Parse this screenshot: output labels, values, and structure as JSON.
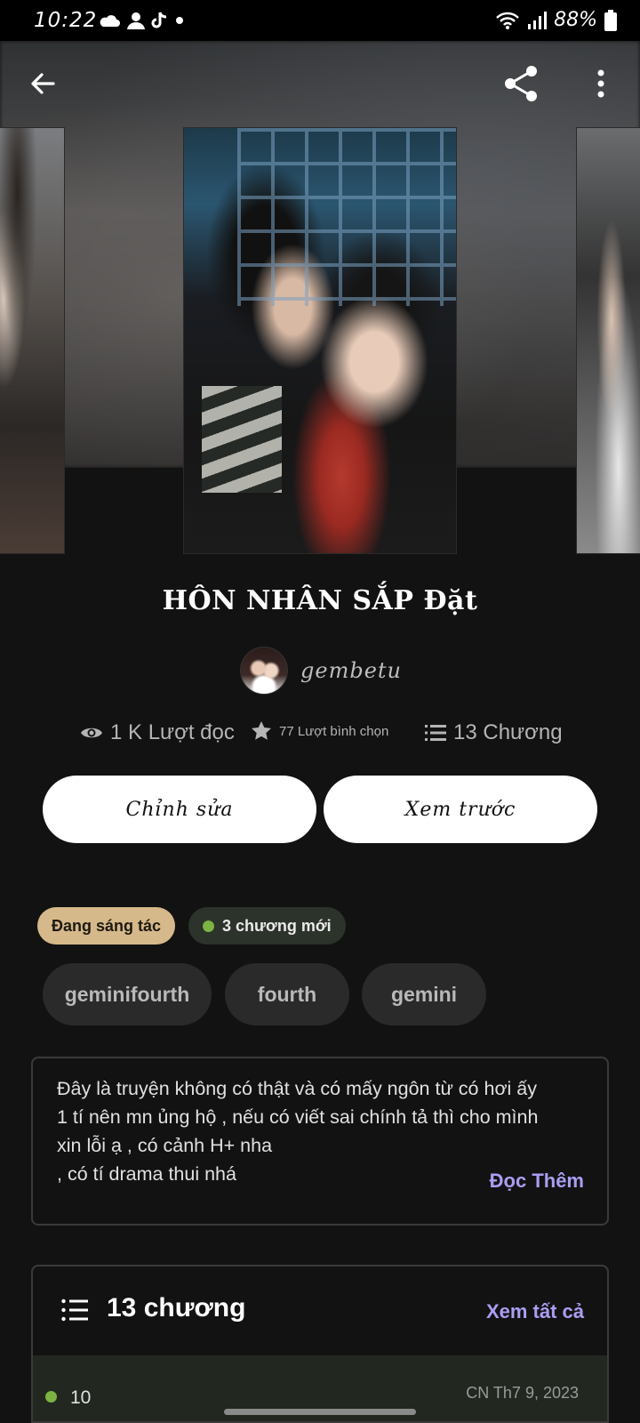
{
  "status_bar": {
    "time": "10:22",
    "battery": "88%",
    "icons_left": [
      "cloud-icon",
      "person-icon",
      "tiktok-icon",
      "dot-icon"
    ],
    "icons_right": [
      "wifi-icon",
      "signal-icon",
      "battery-icon"
    ]
  },
  "nav": {
    "back_icon": "back-arrow-icon",
    "share_icon": "share-icon",
    "more_icon": "more-vertical-icon"
  },
  "story": {
    "title": "HÔN NHÂN SẮP Đặt",
    "author": "gembetu"
  },
  "stats": {
    "reads": "1 K Lượt đọc",
    "votes": "77 Lượt bình chọn",
    "chapters": "13 Chương"
  },
  "actions": {
    "edit": "Chỉnh sửa",
    "preview": "Xem trước"
  },
  "badges": {
    "status": "Đang sáng tác",
    "new_chapters": "3 chương mới"
  },
  "tags": [
    "geminifourth",
    "fourth",
    "gemini"
  ],
  "description": {
    "text": "Đây là truyện không có thật và có mấy ngôn từ có hơi ấy\n1 tí nên mn ủng hộ , nếu có viết sai chính tả thì cho mình\nxin lỗi ạ , có cảnh H+ nha\n, có tí drama thui nhá",
    "read_more": "Đọc Thêm"
  },
  "chapters_section": {
    "title": "13 chương",
    "see_all": "Xem tất cả",
    "first_row": {
      "number": "10",
      "date": "CN Th7 9, 2023"
    }
  },
  "colors": {
    "background": "#121212",
    "accent_link": "#a99ef2",
    "status_chip": "#d6b98a",
    "new_dot": "#7cb342"
  }
}
